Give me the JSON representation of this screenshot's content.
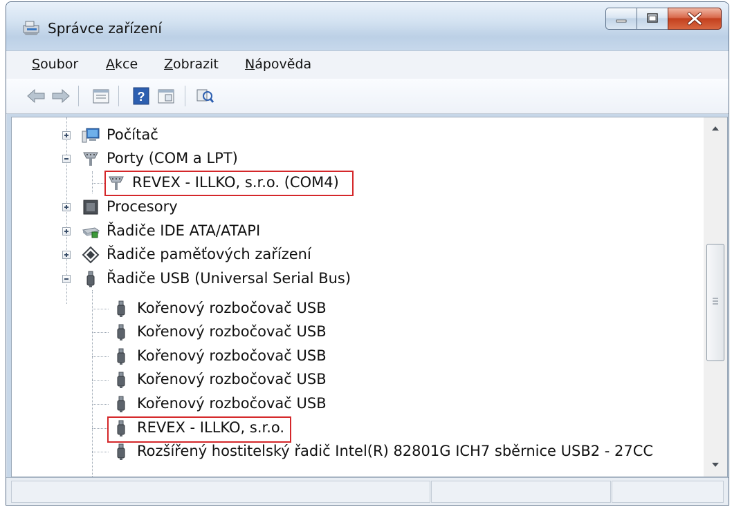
{
  "window": {
    "title": "Správce zařízení",
    "title_icon": "device-manager-icon"
  },
  "menu": [
    {
      "label": "Soubor",
      "accel": "S",
      "rest": "oubor"
    },
    {
      "label": "Akce",
      "accel": "A",
      "rest": "kce"
    },
    {
      "label": "Zobrazit",
      "accel": "Z",
      "rest": "obrazit"
    },
    {
      "label": "Nápověda",
      "accel": "N",
      "rest": "ápověda"
    }
  ],
  "toolbar": {
    "back_icon": "back-arrow-icon",
    "forward_icon": "forward-arrow-icon",
    "properties_icon": "properties-icon",
    "help_icon": "help-icon",
    "view_icon": "view-icon",
    "scan_icon": "scan-hardware-icon"
  },
  "tree": {
    "items": [
      {
        "label": "Počítač",
        "icon": "computer-icon",
        "level": 1,
        "expander": "plus"
      },
      {
        "label": "Porty (COM a LPT)",
        "icon": "port-icon",
        "level": 1,
        "expander": "minus"
      },
      {
        "label": "REVEX - ILLKO, s.r.o. (COM4)",
        "icon": "port-icon",
        "level": 2,
        "highlight": true
      },
      {
        "label": "Procesory",
        "icon": "processor-icon",
        "level": 1,
        "expander": "plus"
      },
      {
        "label": "Řadiče IDE ATA/ATAPI",
        "icon": "ide-controller-icon",
        "level": 1,
        "expander": "plus"
      },
      {
        "label": "Řadiče paměťových zařízení",
        "icon": "storage-controller-icon",
        "level": 1,
        "expander": "plus"
      },
      {
        "label": "Řadiče USB (Universal Serial Bus)",
        "icon": "usb-icon",
        "level": 1,
        "expander": "minus"
      },
      {
        "label": "Kořenový rozbočovač USB",
        "icon": "usb-icon",
        "level": 2
      },
      {
        "label": "Kořenový rozbočovač USB",
        "icon": "usb-icon",
        "level": 2
      },
      {
        "label": "Kořenový rozbočovač USB",
        "icon": "usb-icon",
        "level": 2
      },
      {
        "label": "Kořenový rozbočovač USB",
        "icon": "usb-icon",
        "level": 2
      },
      {
        "label": "Kořenový rozbočovač USB",
        "icon": "usb-icon",
        "level": 2
      },
      {
        "label": "REVEX - ILLKO, s.r.o.",
        "icon": "usb-icon",
        "level": 2,
        "highlight": true
      },
      {
        "label": "Rozšířený hostitelský řadič Intel(R) 82801G ICH7 sběrnice USB2 - 27CC",
        "icon": "usb-icon",
        "level": 2
      }
    ]
  },
  "colors": {
    "highlight_border": "#d4272a",
    "titlebar": "#c8d9ec",
    "close_button": "#c3401f"
  }
}
